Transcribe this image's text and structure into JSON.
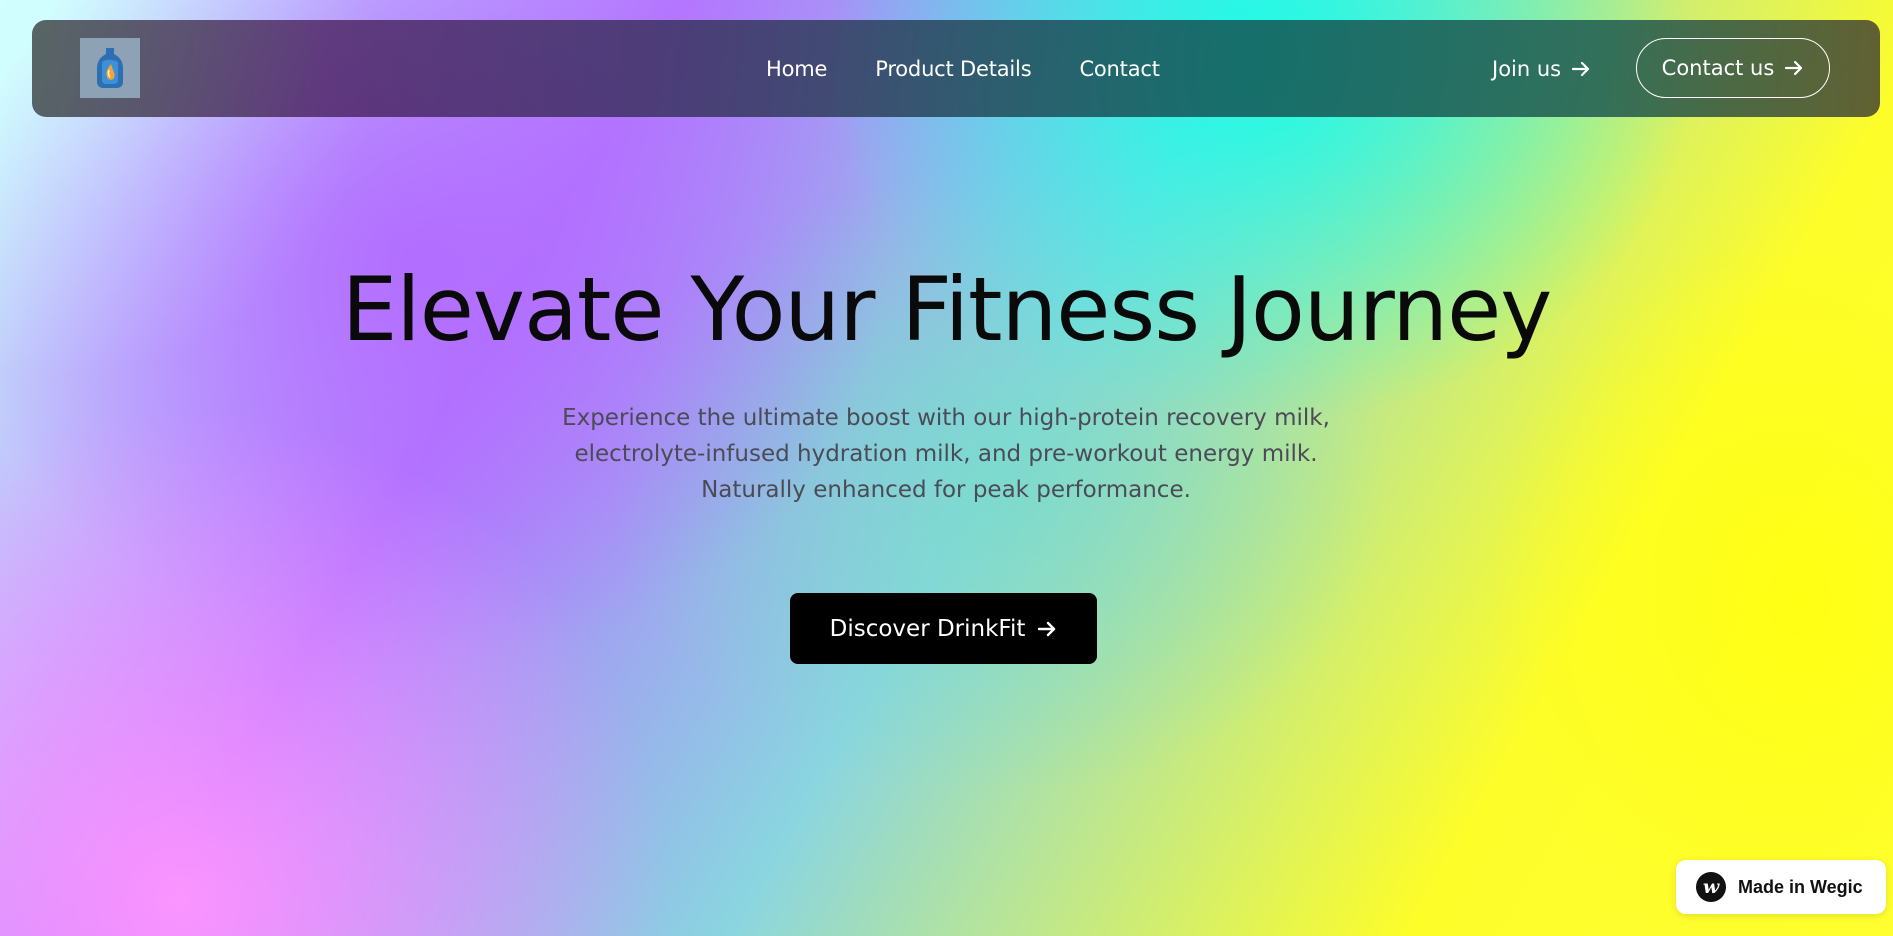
{
  "nav": {
    "links": [
      "Home",
      "Product Details",
      "Contact"
    ],
    "join_label": "Join us",
    "contact_label": "Contact us"
  },
  "hero": {
    "title": "Elevate Your Fitness Journey",
    "subtitle_lines": [
      "Experience the ultimate boost with our high-protein recovery milk,",
      "electrolyte-infused hydration milk, and pre-workout energy milk.",
      "Naturally enhanced for peak performance."
    ],
    "cta_label": "Discover DrinkFit"
  },
  "badge": {
    "label": "Made in Wegic",
    "icon_letter": "w"
  },
  "icons": {
    "logo": "bottle-logo-icon",
    "arrow": "arrow-right-icon"
  },
  "colors": {
    "cta_bg": "#000000",
    "nav_text": "#ffffff",
    "title": "#0a0a0a",
    "subtitle": "#4b4b57"
  }
}
